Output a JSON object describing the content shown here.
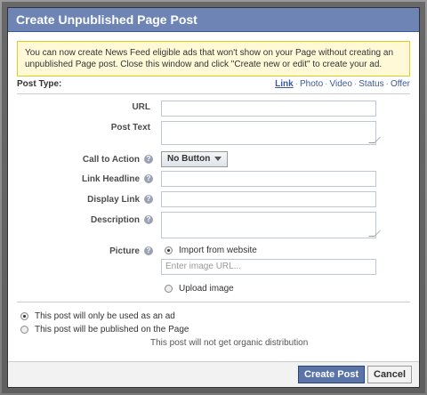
{
  "dialog": {
    "title": "Create Unpublished Page Post",
    "notice": "You can now create News Feed eligible ads that won't show on your Page without creating an unpublished Page post. Close this window and click \"Create new or edit\" to create your ad."
  },
  "post_type": {
    "label": "Post Type:",
    "options": [
      "Link",
      "Photo",
      "Video",
      "Status",
      "Offer"
    ],
    "selected": "Link"
  },
  "form": {
    "url_label": "URL",
    "post_text_label": "Post Text",
    "cta_label": "Call to Action",
    "cta_value": "No Button",
    "link_headline_label": "Link Headline",
    "display_link_label": "Display Link",
    "description_label": "Description",
    "picture_label": "Picture",
    "import_option": "Import from website",
    "image_url_placeholder": "Enter image URL...",
    "upload_option": "Upload image"
  },
  "distribution": {
    "ad_only": "This post will only be used as an ad",
    "published": "This post will be published on the Page",
    "note": "This post will not get organic distribution"
  },
  "footer": {
    "create_label": "Create Post",
    "cancel_label": "Cancel"
  },
  "colors": {
    "title_bar": "#6d84b4",
    "primary_button": "#5b74a8",
    "notice_bg": "#fff9d7"
  }
}
